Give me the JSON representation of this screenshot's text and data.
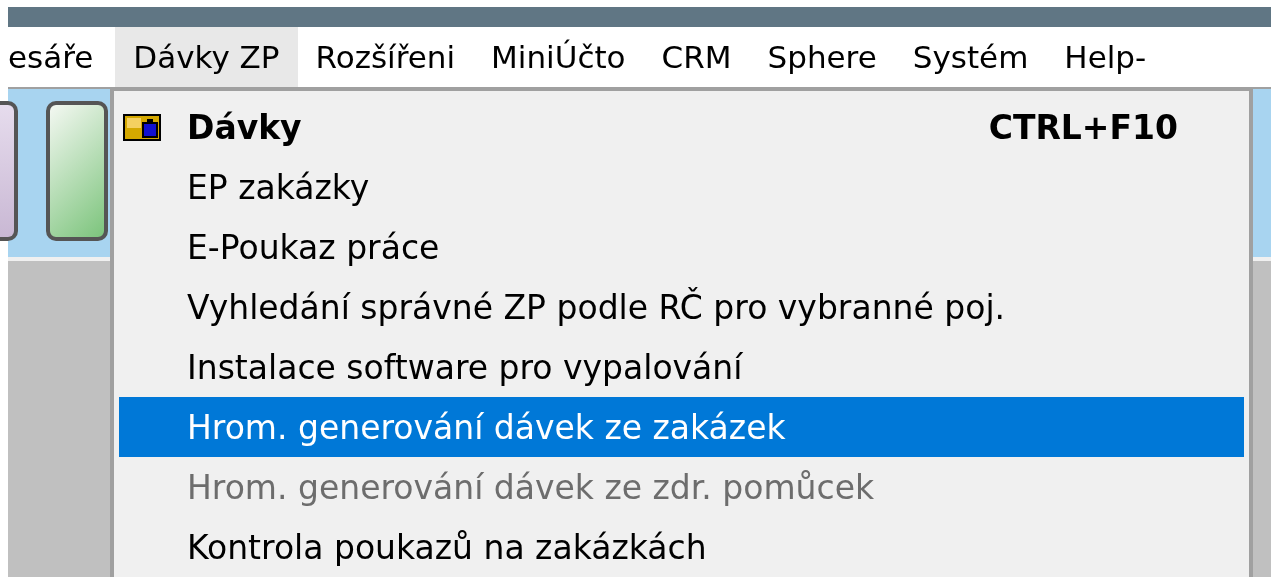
{
  "menubar": [
    {
      "label": "esáře",
      "selected": false
    },
    {
      "label": "Dávky ZP",
      "selected": true
    },
    {
      "label": "Rozšířeni",
      "selected": false
    },
    {
      "label": "MiniÚčto",
      "selected": false
    },
    {
      "label": "CRM",
      "selected": false
    },
    {
      "label": "Sphere",
      "selected": false
    },
    {
      "label": "Systém",
      "selected": false
    },
    {
      "label": "Help-",
      "selected": false
    }
  ],
  "menu": {
    "items": [
      {
        "label": "Dávky",
        "shortcut": "CTRL+F10",
        "kind": "default",
        "selected": false,
        "disabled": false
      },
      {
        "label": "EP zakázky",
        "kind": "normal",
        "selected": false,
        "disabled": false
      },
      {
        "label": "E-Poukaz práce",
        "kind": "normal",
        "selected": false,
        "disabled": false
      },
      {
        "label": "Vyhledání správné ZP podle RČ pro vybranné poj.",
        "kind": "normal",
        "selected": false,
        "disabled": false
      },
      {
        "label": "Instalace software pro vypalování",
        "kind": "normal",
        "selected": false,
        "disabled": false
      },
      {
        "label": "Hrom. generování dávek ze zakázek",
        "kind": "normal",
        "selected": true,
        "disabled": false
      },
      {
        "label": "Hrom. generování dávek ze zdr. pomůcek",
        "kind": "normal",
        "selected": false,
        "disabled": true
      },
      {
        "label": "Kontrola poukazů na zakázkách",
        "kind": "normal",
        "selected": false,
        "disabled": false
      }
    ]
  }
}
